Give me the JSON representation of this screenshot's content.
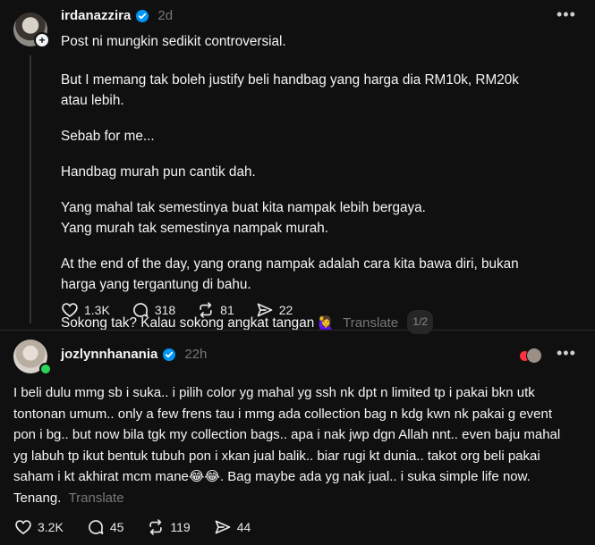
{
  "post1": {
    "username": "irdanazzira",
    "time": "2d",
    "paragraphs": [
      "Post ni mungkin sedikit controversial.",
      "But I memang tak boleh justify beli handbag yang harga dia RM10k, RM20k atau lebih.",
      "Sebab for me...",
      "Handbag murah pun cantik dah.",
      "Yang mahal tak semestinya buat kita nampak lebih bergaya.\nYang murah tak semestinya nampak murah.",
      "At the end of the day, yang orang nampak adalah cara kita bawa diri, bukan harga yang tergantung di bahu."
    ],
    "last_line": "Sokong tak? Kalau sokong angkat tangan",
    "last_emoji": "🙋‍♀️",
    "translate": "Translate",
    "page_indicator": "1/2",
    "likes": "1.3K",
    "replies": "318",
    "reposts": "81",
    "shares": "22"
  },
  "post2": {
    "username": "jozlynnhanania",
    "time": "22h",
    "text": "I beli dulu mmg sb i suka.. i pilih color yg mahal yg ssh nk dpt n limited tp i pakai bkn utk tontonan umum.. only a few frens tau i mmg ada collection bag n kdg kwn nk pakai g event pon i bg.. but now bila tgk my collection bags.. apa i nak jwp dgn Allah nnt.. even baju mahal yg labuh tp ikut bentuk tubuh pon i xkan jual balik.. biar rugi kt dunia.. takot org beli pakai saham i kt akhirat mcm mane😂😂. Bag maybe ada yg nak jual.. i suka simple life now. Tenang.",
    "translate": "Translate",
    "likes": "3.2K",
    "replies": "45",
    "reposts": "119",
    "shares": "44"
  },
  "icons": {
    "more": "more-dots-icon",
    "verified": "verified-badge-icon",
    "heart": "heart-icon",
    "reply": "reply-bubble-icon",
    "repost": "repost-icon",
    "share": "share-send-icon"
  },
  "colors": {
    "background": "#101010",
    "verified": "#0095f6",
    "online": "#2bd45b",
    "muted": "#777777"
  }
}
